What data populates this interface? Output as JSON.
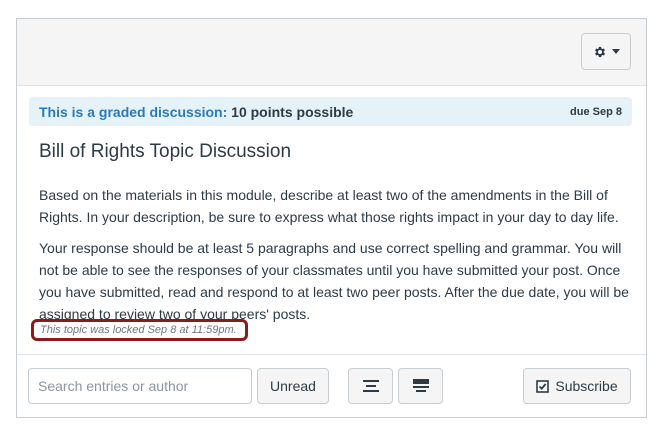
{
  "header": {
    "settings_icon": "gear-icon",
    "dropdown_icon": "caret-down-icon"
  },
  "banner": {
    "lead": "This is a graded discussion:",
    "points": "10 points possible",
    "due": "due Sep 8",
    "colors": {
      "background": "#e5f2f8",
      "lead": "#2b7abc"
    }
  },
  "discussion": {
    "title": "Bill of Rights Topic Discussion",
    "paragraphs": [
      "Based on the materials in this module, describe at least two of the amendments in the Bill of Rights. In your description, be sure to express what those rights impact in your day to day life.",
      "Your response should be at least 5 paragraphs and use correct spelling and grammar. You will not be able to see the responses of your classmates until you have submitted your post. Once you have submitted, read and respond to at least two peer posts. After the due date, you will be assigned to review two of your peers' posts."
    ],
    "locked_note": "This topic was locked Sep 8 at 11:59pm.",
    "highlight_color": "#8b1a1a"
  },
  "toolbar": {
    "search_placeholder": "Search entries or author",
    "search_value": "",
    "unread_label": "Unread",
    "expand_icon": "expand-threads-icon",
    "collapse_icon": "collapse-threads-icon",
    "subscribe_icon": "checkbox-checked-icon",
    "subscribe_label": "Subscribe"
  }
}
